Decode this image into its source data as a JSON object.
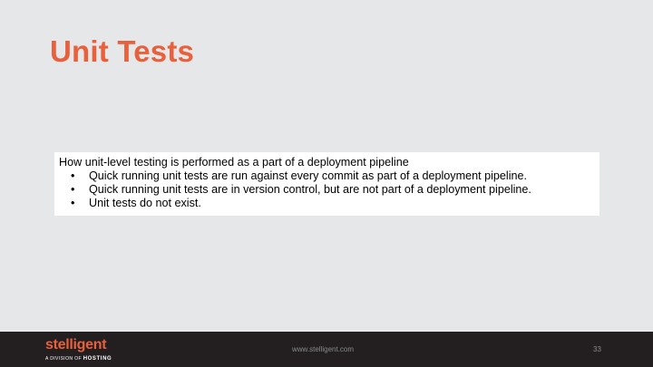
{
  "slide": {
    "title": "Unit Tests",
    "intro": "How unit-level testing is performed as a part of a deployment pipeline",
    "bullet_symbol": "•",
    "bullets": [
      "Quick running unit tests are run against every commit as part of a deployment pipeline.",
      "Quick running unit tests are in version control, but are not part of a deployment pipeline.",
      "Unit tests do not exist."
    ]
  },
  "footer": {
    "logo_word": "stelligent",
    "logo_sub_prefix": "A DIVISION OF",
    "logo_sub_brand": "HOSTING",
    "url": "www.stelligent.com",
    "page_number": "33"
  },
  "colors": {
    "accent": "#e8603c",
    "background": "#e6e7e8",
    "footer": "#231f20"
  }
}
